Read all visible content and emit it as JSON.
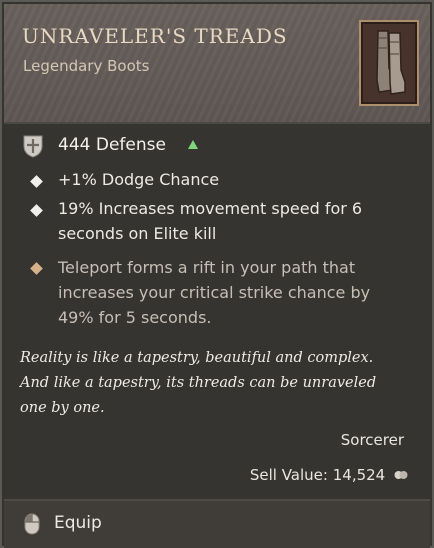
{
  "item": {
    "name": "UNRAVELER'S TREADS",
    "type": "Legendary Boots",
    "icon": "boots-icon"
  },
  "stats": {
    "defense_label": "444 Defense",
    "defense_change_icon": "up-arrow-icon",
    "defense_change_color": "#7fd67a"
  },
  "affixes": [
    {
      "line1": "+1% Dodge Chance"
    },
    {
      "line1": "19% Increases movement speed for 6",
      "line2": "seconds on Elite kill"
    }
  ],
  "aspect": {
    "line1": "Teleport forms a rift in your path that",
    "line2": "increases your critical strike chance by",
    "line3": "49% for 5 seconds."
  },
  "flavor": {
    "line1": "Reality is like a tapestry, beautiful and complex.",
    "line2": "And like a tapestry, its threads can be unraveled",
    "line3": "one by one."
  },
  "class_requirement": "Sorcerer",
  "sell_value": "Sell Value: 14,524",
  "footer": {
    "action_label": "Equip",
    "action_icon": "mouse-icon"
  },
  "colors": {
    "header_bg": "#6a615d",
    "body_bg": "#363430",
    "name_color": "#e8d9c2",
    "legendary_bullet": "#d7b18a"
  }
}
